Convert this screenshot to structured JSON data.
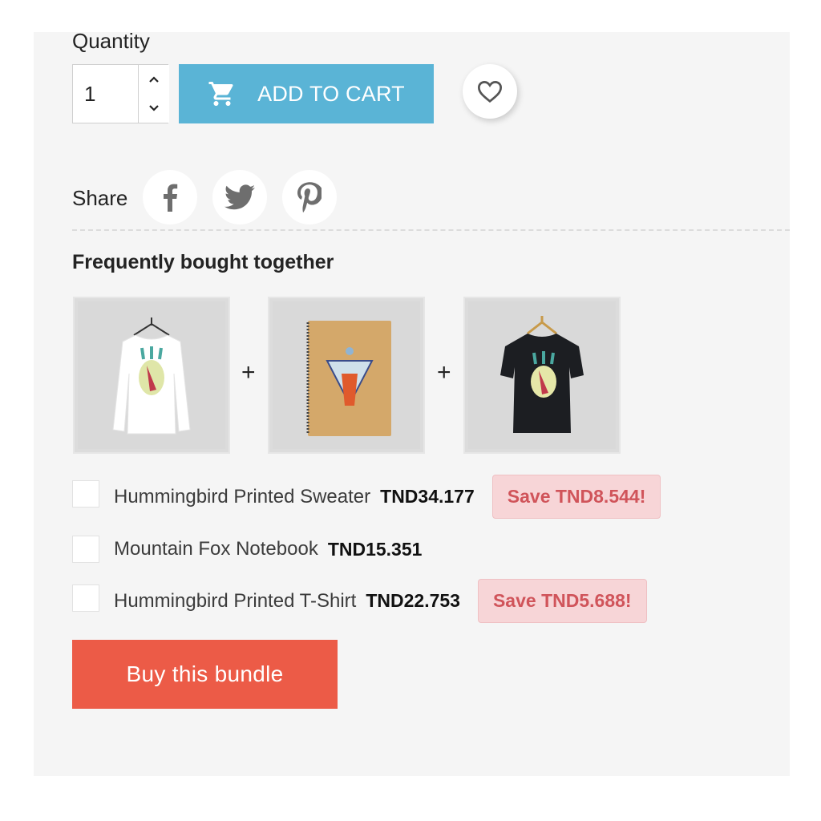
{
  "quantity": {
    "label": "Quantity",
    "value": "1",
    "increment_icon": "chevron-up-icon",
    "decrement_icon": "chevron-down-icon"
  },
  "add_to_cart": {
    "label": "ADD TO CART",
    "icon": "shopping-cart-icon",
    "color": "#5ab4d6"
  },
  "wishlist": {
    "icon": "heart-outline-icon"
  },
  "share": {
    "label": "Share",
    "networks": [
      {
        "name": "Facebook",
        "icon": "facebook-icon"
      },
      {
        "name": "Twitter",
        "icon": "twitter-icon"
      },
      {
        "name": "Pinterest",
        "icon": "pinterest-icon"
      }
    ]
  },
  "bundle": {
    "title": "Frequently bought together",
    "separator": "+",
    "products": [
      {
        "name": "Hummingbird Printed Sweater",
        "price": "TND34.177",
        "save": "Save TND8.544!",
        "checked": false,
        "image": "white long-sleeve sweater on hanger"
      },
      {
        "name": "Mountain Fox Notebook",
        "price": "TND15.351",
        "save": null,
        "checked": false,
        "image": "kraft spiral notebook with fox print"
      },
      {
        "name": "Hummingbird Printed T-Shirt",
        "price": "TND22.753",
        "save": "Save TND5.688!",
        "checked": false,
        "image": "black t-shirt on hanger"
      }
    ],
    "button_label": "Buy this bundle",
    "button_color": "#ec5b47",
    "save_badge_color": "#d0545a"
  }
}
